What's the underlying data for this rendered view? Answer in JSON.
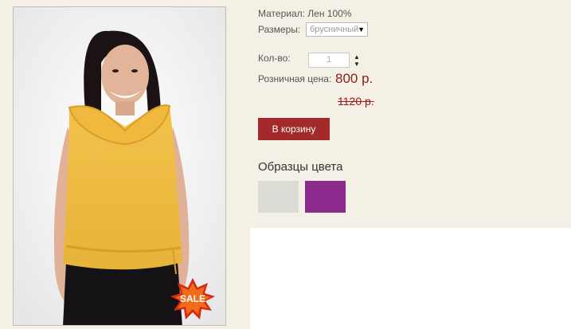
{
  "product": {
    "material": "Материал: Лен 100%",
    "sizes_label": "Размеры:",
    "size_selected": "брусничный",
    "qty_label": "Кол-во:",
    "qty_value": "1",
    "price_label": "Розничная цена:",
    "price_new": "800 р.",
    "price_old": "1120 р.",
    "cart_button": "В корзину",
    "samples_title": "Образцы цвета",
    "sale_badge": "SALE"
  },
  "swatches": [
    {
      "name": "light-gray",
      "color": "#dcdcd6"
    },
    {
      "name": "purple",
      "color": "#8c2a8e"
    }
  ],
  "colors": {
    "accent": "#a32a2a",
    "price": "#8b1a1a",
    "background": "#f4f0e6"
  },
  "icons": {
    "select_arrow": "dropdown-arrow-icon",
    "stepper_up": "arrow-up-icon",
    "stepper_down": "arrow-down-icon"
  }
}
